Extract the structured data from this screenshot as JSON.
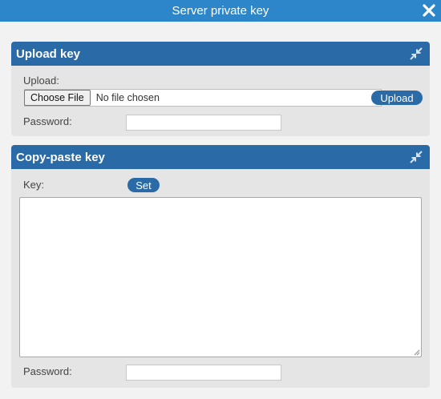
{
  "dialog": {
    "title": "Server private key",
    "close_icon": "close-icon"
  },
  "upload_panel": {
    "title": "Upload key",
    "collapse_icon": "collapse-arrows-icon",
    "upload_label": "Upload:",
    "choose_file_label": "Choose File",
    "file_status": "No file chosen",
    "upload_button": "Upload",
    "password_label": "Password:",
    "password_value": ""
  },
  "paste_panel": {
    "title": "Copy-paste key",
    "collapse_icon": "collapse-arrows-icon",
    "key_label": "Key:",
    "set_button": "Set",
    "key_value": "",
    "password_label": "Password:",
    "password_value": ""
  },
  "colors": {
    "titlebar": "#2d86c9",
    "panel_header": "#2a6aa6",
    "panel_body": "#e5e5e5",
    "background": "#f2f2f2"
  }
}
